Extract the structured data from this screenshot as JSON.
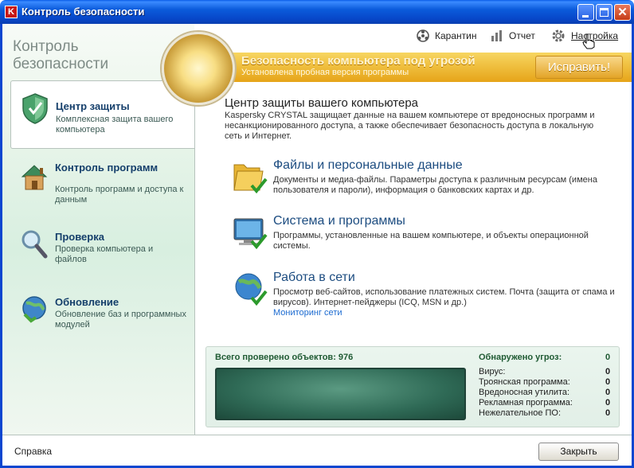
{
  "window": {
    "title": "Контроль безопасности",
    "app_icon_letter": "K"
  },
  "app_heading": "Контроль безопасности",
  "toolbar": {
    "quarantine_label": "Карантин",
    "report_label": "Отчет",
    "settings_label": "Настройка"
  },
  "banner": {
    "title": "Безопасность компьютера под угрозой",
    "subtitle": "Установлена пробная версия программы",
    "fix_label": "Исправить!"
  },
  "nav": {
    "items": [
      {
        "title": "Центр защиты",
        "desc": "Комплексная защита вашего компьютера"
      },
      {
        "title": "Контроль программ",
        "desc": "Контроль программ и доступа к данным"
      },
      {
        "title": "Проверка",
        "desc": "Проверка компьютера и файлов"
      },
      {
        "title": "Обновление",
        "desc": "Обновление баз и программных модулей"
      }
    ]
  },
  "main": {
    "title": "Центр защиты вашего компьютера",
    "desc": "Kaspersky CRYSTAL защищает данные на вашем компьютере от вредоносных программ и несанкционированного доступа, а также обеспечивает безопасность доступа в локальную сеть и Интернет.",
    "sections": [
      {
        "title": "Файлы и персональные данные",
        "desc": "Документы и медиа-файлы. Параметры доступа к различным ресурсам (имена пользователя и пароли), информация о банковских картах и др."
      },
      {
        "title": "Система и программы",
        "desc": "Программы, установленные на вашем компьютере, и объекты операционной системы."
      },
      {
        "title": "Работа в сети",
        "desc": "Просмотр веб-сайтов, использование платежных систем. Почта (защита от спама и вирусов). Интернет-пейджеры (ICQ, MSN и др.)",
        "link": "Мониторинг сети"
      }
    ]
  },
  "stats": {
    "scanned_label": "Всего проверено объектов: 976",
    "threats_title": "Обнаружено угроз:",
    "threats_total": "0",
    "rows": [
      {
        "label": "Вирус:",
        "value": "0"
      },
      {
        "label": "Троянская программа:",
        "value": "0"
      },
      {
        "label": "Вредоносная утилита:",
        "value": "0"
      },
      {
        "label": "Рекламная программа:",
        "value": "0"
      },
      {
        "label": "Нежелательное ПО:",
        "value": "0"
      }
    ]
  },
  "footer": {
    "help_label": "Справка",
    "close_label": "Закрыть"
  },
  "colors": {
    "titlebar": "#0b5bdb",
    "banner": "#e6a418",
    "nav_title": "#153f6b",
    "section_title": "#1c4c80",
    "link": "#1b6ad0"
  }
}
